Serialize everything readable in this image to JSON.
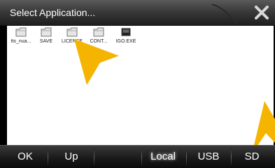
{
  "dialog": {
    "title": "Select Application..."
  },
  "files": [
    {
      "name": "tts_nua...",
      "type": "folder"
    },
    {
      "name": "SAVE",
      "type": "folder"
    },
    {
      "name": "LICENSE",
      "type": "folder"
    },
    {
      "name": "CONT...",
      "type": "folder"
    },
    {
      "name": "IGO.EXE",
      "type": "exe"
    }
  ],
  "bottom_bar": {
    "ok_label": "OK",
    "up_label": "Up",
    "local_label": "Local",
    "usb_label": "USB",
    "sd_label": "SD"
  },
  "icons": {
    "close": "close-icon",
    "folder": "folder-icon",
    "exe": "exe-icon"
  },
  "colors": {
    "accent_arrow": "#f5b400",
    "title_bar": "#3a3a3a",
    "file_area": "#ffffff"
  }
}
